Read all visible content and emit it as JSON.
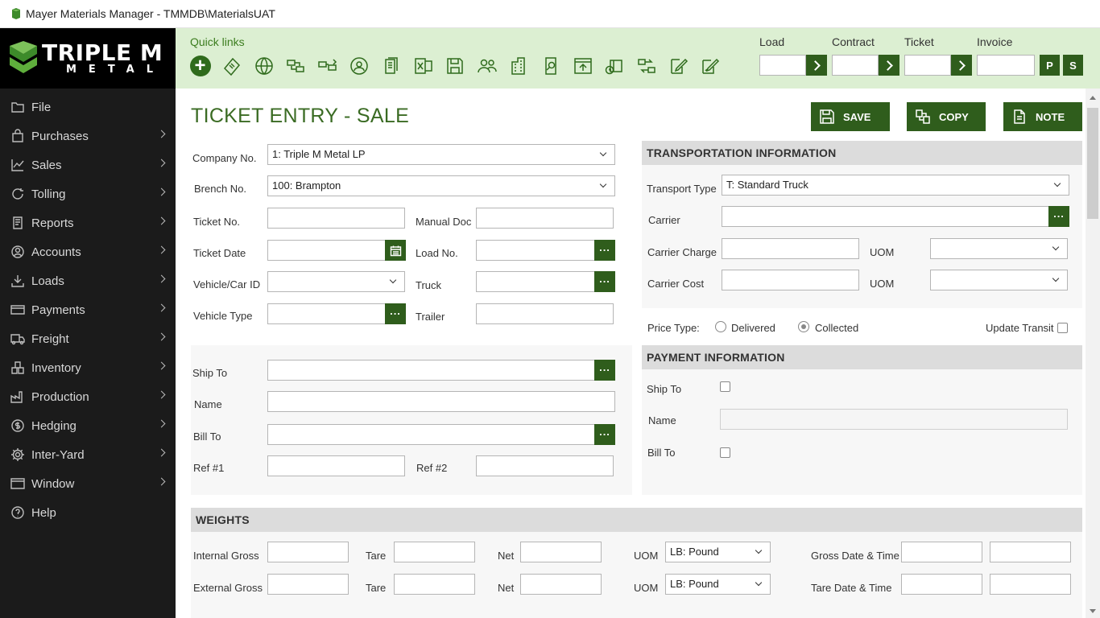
{
  "window": {
    "title": "Mayer Materials Manager - TMMDB\\MaterialsUAT"
  },
  "logo": {
    "line1": "TRIPLE M",
    "line2": "METAL"
  },
  "sidebar": {
    "items": [
      {
        "label": "File",
        "icon": "folder-icon"
      },
      {
        "label": "Purchases",
        "icon": "bag-icon"
      },
      {
        "label": "Sales",
        "icon": "chart-line-icon"
      },
      {
        "label": "Tolling",
        "icon": "refresh-icon"
      },
      {
        "label": "Reports",
        "icon": "report-icon"
      },
      {
        "label": "Accounts",
        "icon": "account-icon"
      },
      {
        "label": "Loads",
        "icon": "download-icon"
      },
      {
        "label": "Payments",
        "icon": "card-icon"
      },
      {
        "label": "Freight",
        "icon": "truck-icon"
      },
      {
        "label": "Inventory",
        "icon": "inventory-icon"
      },
      {
        "label": "Production",
        "icon": "factory-icon"
      },
      {
        "label": "Hedging",
        "icon": "dollar-cycle-icon"
      },
      {
        "label": "Inter-Yard",
        "icon": "gear-icon"
      },
      {
        "label": "Window",
        "icon": "window-icon"
      },
      {
        "label": "Help",
        "icon": "help-icon"
      }
    ]
  },
  "quicklinks": {
    "title": "Quick links",
    "lookups": {
      "load": "Load",
      "contract": "Contract",
      "ticket": "Ticket",
      "invoice": "Invoice"
    },
    "p_label": "P",
    "s_label": "S"
  },
  "page": {
    "title": "TICKET ENTRY - SALE",
    "save": "SAVE",
    "copy": "COPY",
    "note": "NOTE"
  },
  "form": {
    "company_label": "Company No.",
    "company_value": "1: Triple M Metal LP",
    "branch_label": "Brench No.",
    "branch_value": "100: Brampton",
    "ticket_no_label": "Ticket No.",
    "manual_doc_label": "Manual Doc",
    "ticket_date_label": "Ticket Date",
    "load_no_label": "Load No.",
    "vehicle_id_label": "Vehicle/Car ID",
    "truck_label": "Truck",
    "vehicle_type_label": "Vehicle Type",
    "trailer_label": "Trailer",
    "ship_to_label": "Ship To",
    "name_label": "Name",
    "bill_to_label": "Bill To",
    "ref1_label": "Ref #1",
    "ref2_label": "Ref #2"
  },
  "transport": {
    "header": "TRANSPORTATION INFORMATION",
    "type_label": "Transport Type",
    "type_value": "T: Standard Truck",
    "carrier_label": "Carrier",
    "charge_label": "Carrier Charge",
    "uom_label": "UOM",
    "cost_label": "Carrier Cost",
    "uom2_label": "UOM",
    "price_type_label": "Price Type:",
    "delivered_label": "Delivered",
    "collected_label": "Collected",
    "price_type_selected": "Collected",
    "update_transit_label": "Update Transit"
  },
  "payment": {
    "header": "PAYMENT INFORMATION",
    "ship_to_label": "Ship To",
    "name_label": "Name",
    "bill_to_label": "Bill To"
  },
  "weights": {
    "header": "WEIGHTS",
    "internal_gross_label": "Internal Gross",
    "external_gross_label": "External Gross",
    "tare_label": "Tare",
    "net_label": "Net",
    "uom_label": "UOM",
    "uom_value": "LB: Pound",
    "gross_dt_label": "Gross Date & Time",
    "tare_dt_label": "Tare Date & Time"
  },
  "colors": {
    "accent": "#2f5d1c",
    "quickbar_bg": "#dcefd2",
    "sidebar_bg": "#1b1b1b",
    "title_green": "#3a6b23"
  }
}
